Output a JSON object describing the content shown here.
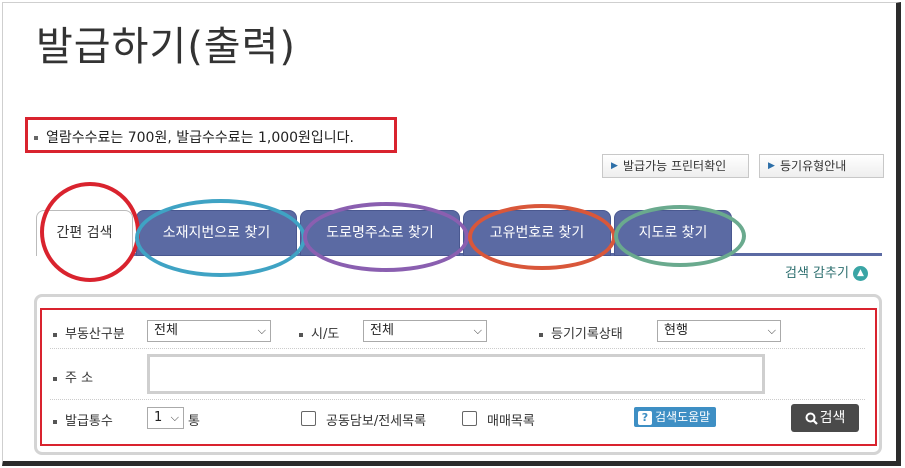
{
  "page": {
    "title": "발급하기(출력)"
  },
  "fee_notice": "열람수수료는 700원, 발급수수료는 1,000원입니다.",
  "top_buttons": [
    {
      "label": "발급가능 프린터확인"
    },
    {
      "label": "등기유형안내"
    }
  ],
  "tabs": [
    {
      "label": "간편 검색",
      "active": true
    },
    {
      "label": "소재지번으로 찾기"
    },
    {
      "label": "도로명주소로 찾기"
    },
    {
      "label": "고유번호로 찾기"
    },
    {
      "label": "지도로 찾기"
    }
  ],
  "colors": {
    "accent_red": "#d9232e",
    "tab_blue": "#5b6aa3",
    "ring_red": "#d9232e",
    "ring_cyan": "#3fa3c4",
    "ring_purple": "#8a5fb0",
    "ring_orange": "#d9573a",
    "ring_green": "#6aaa8e"
  },
  "search_toggle": {
    "label": "검색 감추기",
    "icon": "chevron-up-icon"
  },
  "form": {
    "property_type": {
      "label": "부동산구분",
      "value": "전체"
    },
    "region": {
      "label": "시/도",
      "value": "전체"
    },
    "record_status": {
      "label": "등기기록상태",
      "value": "현행"
    },
    "address": {
      "label": "주 소",
      "value": ""
    },
    "copies": {
      "label": "발급통수",
      "value": "1",
      "unit": "통"
    },
    "joint_collateral": {
      "label": "공동담보/전세목록"
    },
    "sale_list": {
      "label": "매매목록"
    },
    "help_button": {
      "label": "검색도움말"
    },
    "search_button": {
      "label": "검색"
    }
  }
}
